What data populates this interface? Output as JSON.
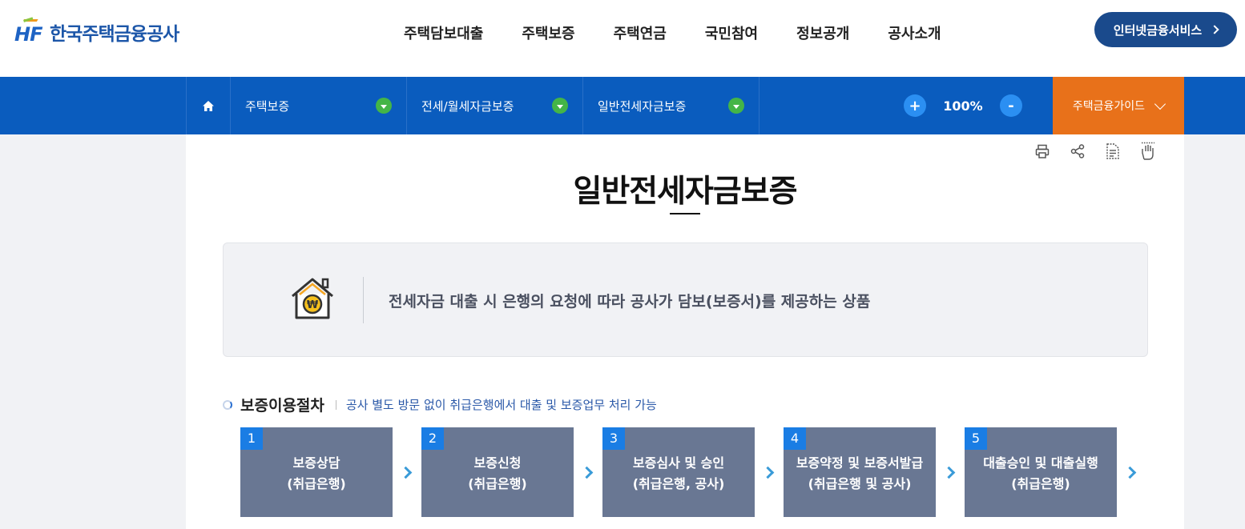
{
  "header": {
    "logo_text": "한국주택금융공사",
    "logo_mark": "HF",
    "nav": [
      "주택담보대출",
      "주택보증",
      "주택연금",
      "국민참여",
      "정보공개",
      "공사소개"
    ],
    "internet_button": "인터넷금융서비스"
  },
  "location": {
    "home_icon": "home-icon",
    "segments": [
      "주택보증",
      "전세/월세자금보증",
      "일반전세자금보증"
    ],
    "zoom_plus": "+",
    "zoom_value": "100%",
    "zoom_minus": "-",
    "guide_label": "주택금융가이드"
  },
  "tools": [
    "print-icon",
    "share-icon",
    "document-icon",
    "sign-language-icon"
  ],
  "page": {
    "title": "일반전세자금보증",
    "summary": "전세자금 대출 시 은행의 요청에 따라 공사가 담보(보증서)를 제공하는 상품"
  },
  "procedure": {
    "title": "보증이용절차",
    "subtitle": "공사 별도 방문 없이 취급은행에서 대출 및 보증업무 처리 가능",
    "steps": [
      {
        "num": "1",
        "line1": "보증상담",
        "line2": "(취급은행)"
      },
      {
        "num": "2",
        "line1": "보증신청",
        "line2": "(취급은행)"
      },
      {
        "num": "3",
        "line1": "보증심사 및 승인",
        "line2": "(취급은행, 공사)"
      },
      {
        "num": "4",
        "line1": "보증약정 및 보증서발급",
        "line2": "(취급은행 및 공사)"
      },
      {
        "num": "5",
        "line1": "대출승인 및 대출실행",
        "line2": "(취급은행)"
      }
    ]
  },
  "colors": {
    "brand_blue": "#0a5cbe",
    "guide_orange": "#e8711a",
    "step_gray": "#697793",
    "step_num_blue": "#1a7de4",
    "dropdown_green": "#44b547"
  }
}
